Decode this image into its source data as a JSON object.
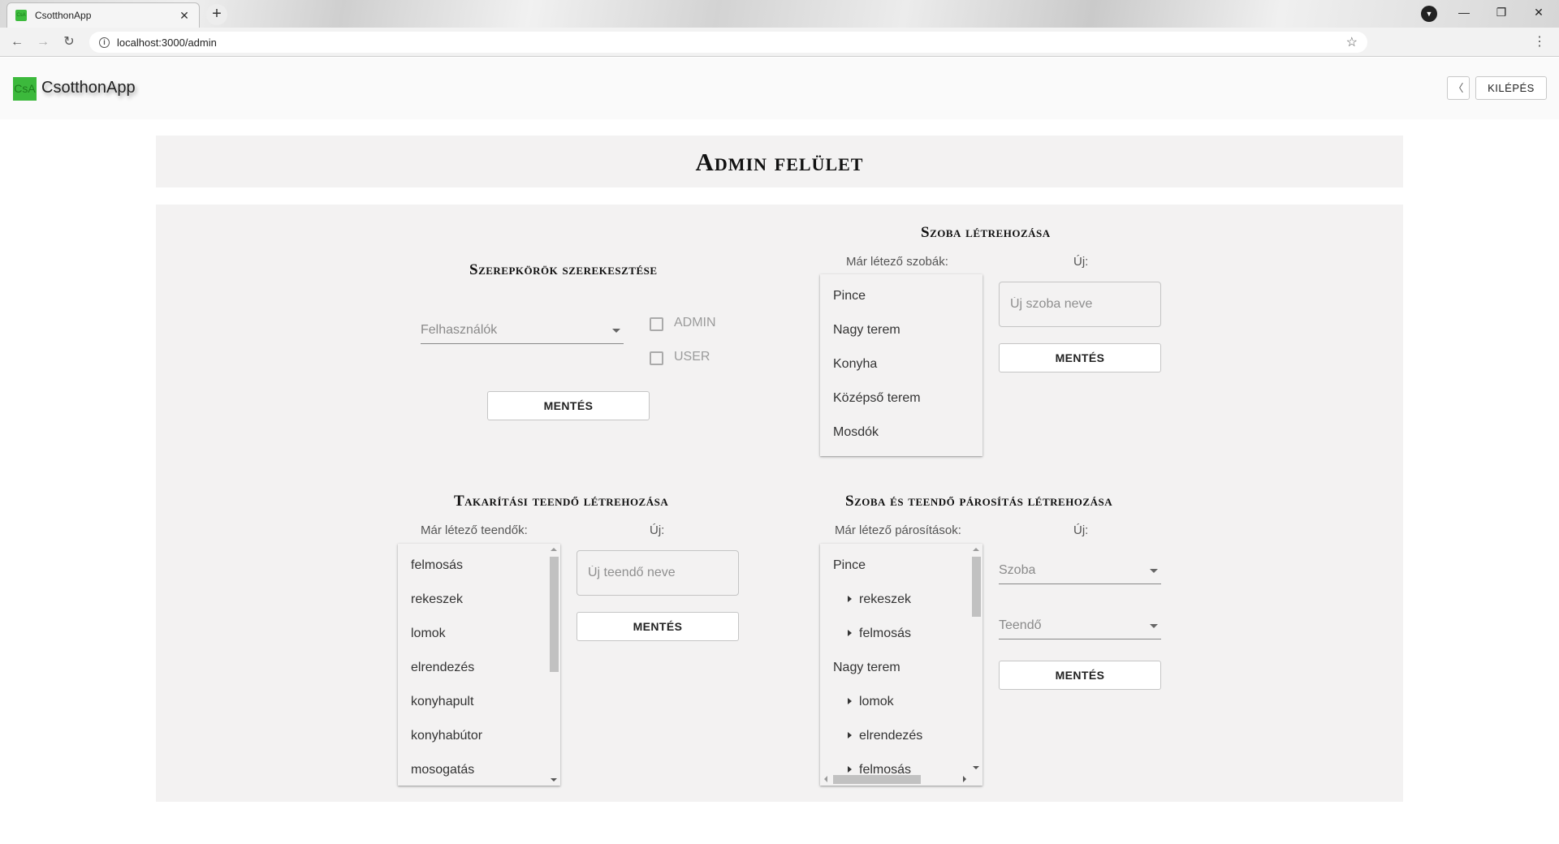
{
  "browser": {
    "tab_title": "CsotthonApp",
    "favicon_text": "CsA",
    "url": "localhost:3000/admin",
    "window_controls": {
      "minimize": "—",
      "maximize": "❐",
      "close": "✕"
    },
    "new_tab": "+",
    "tab_close": "✕",
    "nav": {
      "back": "←",
      "forward": "→",
      "reload": "↻"
    },
    "star": "☆",
    "menu": "⋮",
    "info": "i"
  },
  "app": {
    "logo_text": "CsA",
    "name": "CsotthonApp",
    "back_label": "〈",
    "logout_label": "KILÉPÉS"
  },
  "page": {
    "title": "Admin felület"
  },
  "roles": {
    "title": "Szerepkörök szerekesztése",
    "users_select": "Felhasználók",
    "options": [
      "ADMIN",
      "USER"
    ],
    "save_label": "MENTÉS"
  },
  "room_create": {
    "title": "Szoba létrehozása",
    "existing_label": "Már létező szobák:",
    "new_label": "Új:",
    "rooms": [
      "Pince",
      "Nagy terem",
      "Konyha",
      "Középső terem",
      "Mosdók"
    ],
    "placeholder": "Új szoba neve",
    "save_label": "MENTÉS"
  },
  "task_create": {
    "title": "Takarítási teendő létrehozása",
    "existing_label": "Már létező teendők:",
    "new_label": "Új:",
    "tasks": [
      "felmosás",
      "rekeszek",
      "lomok",
      "elrendezés",
      "konyhapult",
      "konyhabútor",
      "mosogatás"
    ],
    "placeholder": "Új teendő neve",
    "save_label": "MENTÉS"
  },
  "pairing": {
    "title": "Szoba és teendő párosítás létrehozása",
    "existing_label": "Már létező párosítások:",
    "new_label": "Új:",
    "tree": [
      {
        "label": "Pince",
        "level": 0
      },
      {
        "label": "rekeszek",
        "level": 1
      },
      {
        "label": "felmosás",
        "level": 1
      },
      {
        "label": "Nagy terem",
        "level": 0
      },
      {
        "label": "lomok",
        "level": 1
      },
      {
        "label": "elrendezés",
        "level": 1
      },
      {
        "label": "felmosás",
        "level": 1
      }
    ],
    "room_select": "Szoba",
    "task_select": "Teendő",
    "save_label": "MENTÉS"
  }
}
